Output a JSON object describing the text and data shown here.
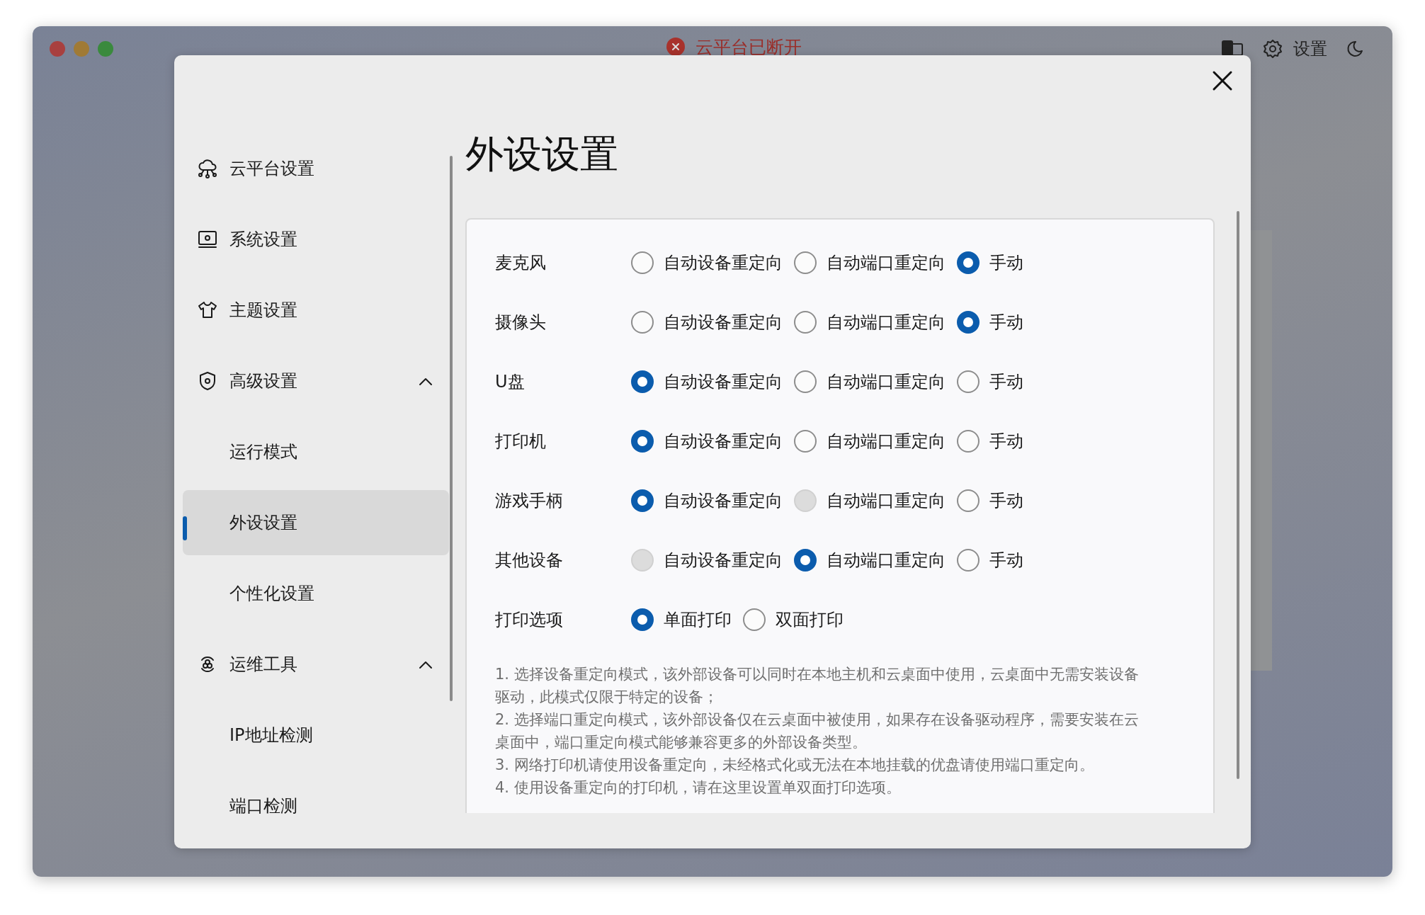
{
  "window": {
    "title": "云平台已断开",
    "toolbar_label": "设置"
  },
  "dialog": {
    "title": "外设设置",
    "sidebar": {
      "items": [
        {
          "label": "云平台设置",
          "selected": false
        },
        {
          "label": "系统设置",
          "selected": false
        },
        {
          "label": "主题设置",
          "selected": false
        },
        {
          "label": "高级设置",
          "selected": false,
          "expanded": true,
          "children": [
            {
              "label": "运行模式",
              "selected": false
            },
            {
              "label": "外设设置",
              "selected": true
            },
            {
              "label": "个性化设置",
              "selected": false
            }
          ]
        },
        {
          "label": "运维工具",
          "selected": false,
          "expanded": true,
          "children": [
            {
              "label": "IP地址检测",
              "selected": false
            },
            {
              "label": "端口检测",
              "selected": false
            }
          ]
        }
      ]
    },
    "rows": [
      {
        "label": "麦克风",
        "options": [
          {
            "label": "自动设备重定向",
            "selected": false,
            "disabled": false
          },
          {
            "label": "自动端口重定向",
            "selected": false,
            "disabled": false
          },
          {
            "label": "手动",
            "selected": true,
            "disabled": false
          }
        ]
      },
      {
        "label": "摄像头",
        "options": [
          {
            "label": "自动设备重定向",
            "selected": false,
            "disabled": false
          },
          {
            "label": "自动端口重定向",
            "selected": false,
            "disabled": false
          },
          {
            "label": "手动",
            "selected": true,
            "disabled": false
          }
        ]
      },
      {
        "label": "U盘",
        "options": [
          {
            "label": "自动设备重定向",
            "selected": true,
            "disabled": false
          },
          {
            "label": "自动端口重定向",
            "selected": false,
            "disabled": false
          },
          {
            "label": "手动",
            "selected": false,
            "disabled": false
          }
        ]
      },
      {
        "label": "打印机",
        "options": [
          {
            "label": "自动设备重定向",
            "selected": true,
            "disabled": false
          },
          {
            "label": "自动端口重定向",
            "selected": false,
            "disabled": false
          },
          {
            "label": "手动",
            "selected": false,
            "disabled": false
          }
        ]
      },
      {
        "label": "游戏手柄",
        "options": [
          {
            "label": "自动设备重定向",
            "selected": true,
            "disabled": false
          },
          {
            "label": "自动端口重定向",
            "selected": false,
            "disabled": true
          },
          {
            "label": "手动",
            "selected": false,
            "disabled": false
          }
        ]
      },
      {
        "label": "其他设备",
        "options": [
          {
            "label": "自动设备重定向",
            "selected": false,
            "disabled": true
          },
          {
            "label": "自动端口重定向",
            "selected": true,
            "disabled": false
          },
          {
            "label": "手动",
            "selected": false,
            "disabled": false
          }
        ]
      },
      {
        "label": "打印选项",
        "options": [
          {
            "label": "单面打印",
            "selected": true,
            "disabled": false
          },
          {
            "label": "双面打印",
            "selected": false,
            "disabled": false
          }
        ]
      }
    ],
    "notes": [
      "1. 选择设备重定向模式，该外部设备可以同时在本地主机和云桌面中使用，云桌面中无需安装设备驱动，此模式仅限于特定的设备；",
      "2. 选择端口重定向模式，该外部设备仅在云桌面中被使用，如果存在设备驱动程序，需要安装在云桌面中，端口重定向模式能够兼容更多的外部设备类型。",
      "3. 网络打印机请使用设备重定向，未经格式化或无法在本地挂载的优盘请使用端口重定向。",
      "4. 使用设备重定向的打印机，请在这里设置单双面打印选项。"
    ]
  }
}
